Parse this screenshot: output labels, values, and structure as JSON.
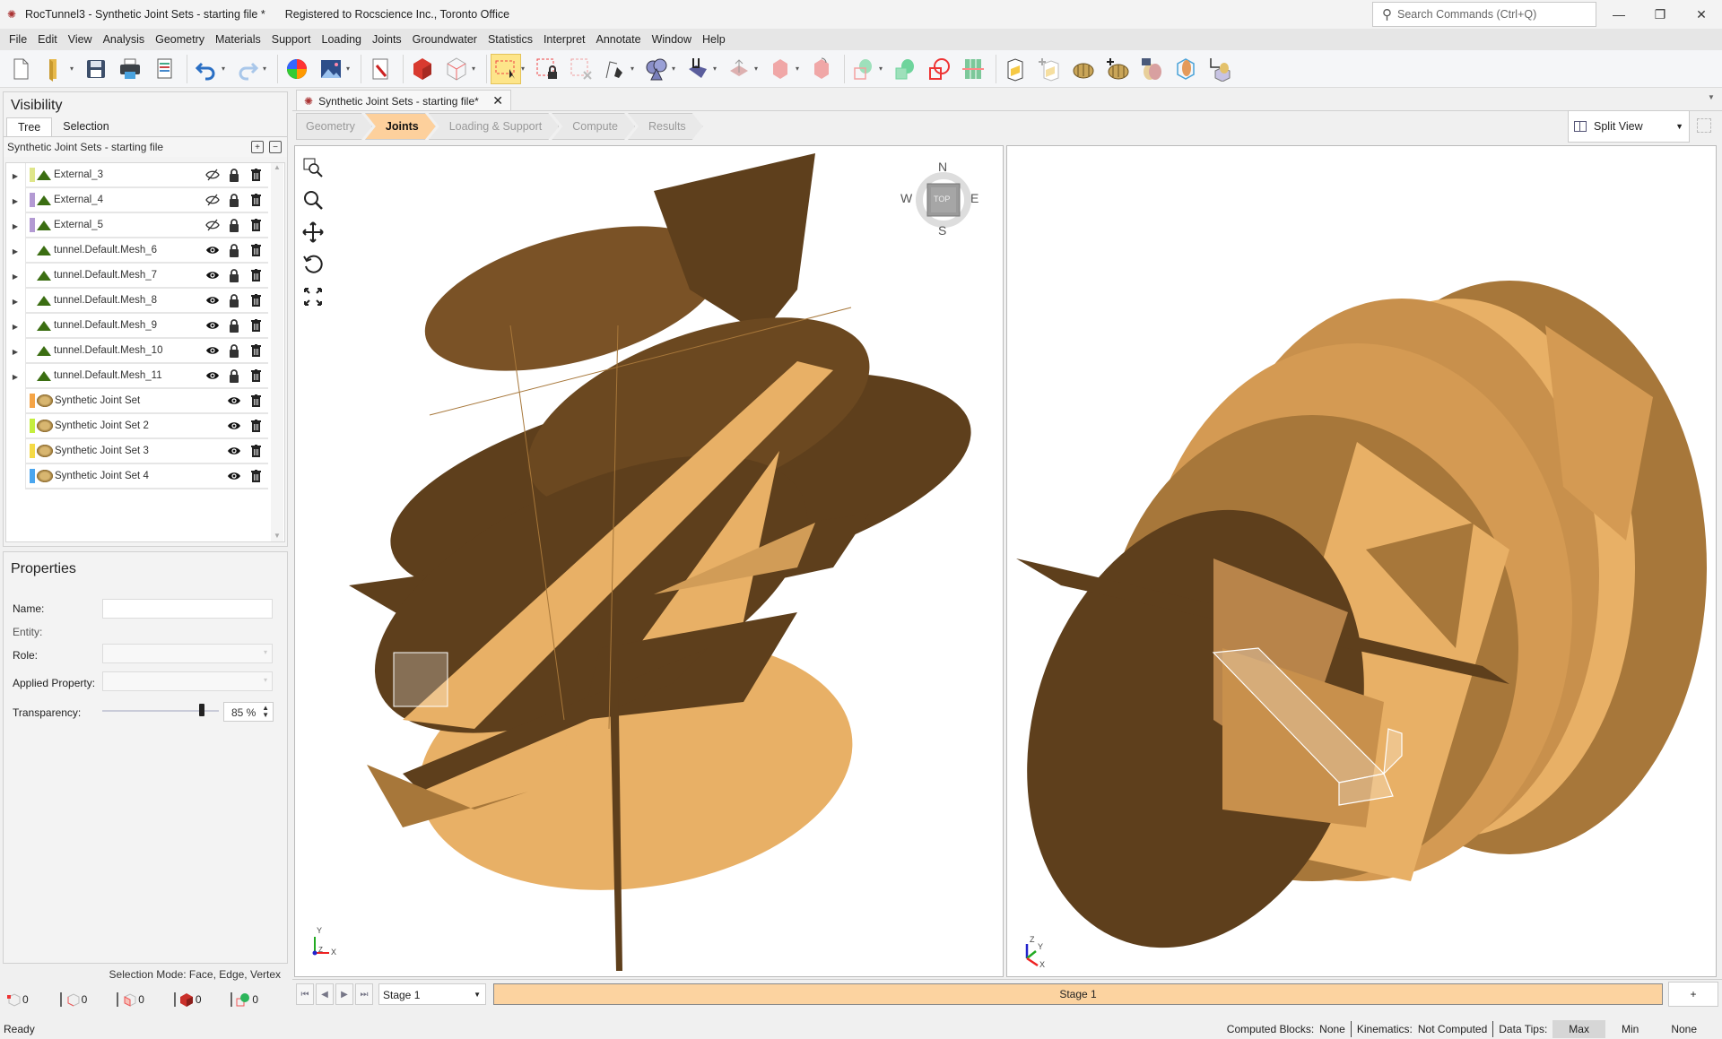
{
  "titlebar": {
    "title": "RocTunnel3 - Synthetic Joint Sets - starting file *",
    "registration": "Registered to Rocscience Inc., Toronto Office",
    "search_placeholder": "Search Commands (Ctrl+Q)",
    "minimize": "—",
    "restore": "❐",
    "close": "✕"
  },
  "menu": [
    "File",
    "Edit",
    "View",
    "Analysis",
    "Geometry",
    "Materials",
    "Support",
    "Loading",
    "Joints",
    "Groundwater",
    "Statistics",
    "Interpret",
    "Annotate",
    "Window",
    "Help"
  ],
  "toolbar": {
    "buttons": [
      {
        "icon": "new-file-icon",
        "dropdown": false
      },
      {
        "icon": "open-folder-icon",
        "dropdown": true
      },
      {
        "icon": "save-icon",
        "dropdown": false
      },
      {
        "icon": "print-icon",
        "dropdown": false
      },
      {
        "icon": "report-icon",
        "dropdown": false
      },
      {
        "icon": "undo-icon",
        "dropdown": true
      },
      {
        "icon": "redo-icon",
        "dropdown": true
      },
      {
        "icon": "color-wheel-icon",
        "dropdown": false
      },
      {
        "icon": "image-export-icon",
        "dropdown": true
      },
      {
        "icon": "project-settings-icon",
        "dropdown": false
      },
      {
        "icon": "solid-view-icon",
        "dropdown": false
      },
      {
        "icon": "wireframe-view-icon",
        "dropdown": true
      },
      {
        "icon": "box-select-icon",
        "dropdown": true,
        "active": true
      },
      {
        "icon": "lock-selection-icon",
        "dropdown": false
      },
      {
        "icon": "clear-selection-icon",
        "dropdown": false
      },
      {
        "icon": "polyline-pen-icon",
        "dropdown": true
      },
      {
        "icon": "shapes-icon",
        "dropdown": true
      },
      {
        "icon": "import-geometry-icon",
        "dropdown": true
      },
      {
        "icon": "extrude-icon",
        "dropdown": true
      },
      {
        "icon": "move-icon",
        "dropdown": true
      },
      {
        "icon": "rotate-icon",
        "dropdown": false
      },
      {
        "icon": "boolean-icon",
        "dropdown": true
      },
      {
        "icon": "union-icon",
        "dropdown": false
      },
      {
        "icon": "intersect-icon",
        "dropdown": false
      },
      {
        "icon": "grid-slice-icon",
        "dropdown": false
      },
      {
        "icon": "edit-joint-icon",
        "dropdown": false
      },
      {
        "icon": "add-joint-icon",
        "dropdown": false
      },
      {
        "icon": "edit-joint-set-icon",
        "dropdown": false
      },
      {
        "icon": "add-joint-set-icon",
        "dropdown": false
      },
      {
        "icon": "joint-table-icon",
        "dropdown": false
      },
      {
        "icon": "joint-box-icon",
        "dropdown": false
      },
      {
        "icon": "crop-box-icon",
        "dropdown": false
      }
    ]
  },
  "visibility": {
    "title": "Visibility",
    "tabs": [
      "Tree",
      "Selection"
    ],
    "active_tab": "Tree",
    "tree_header": "Synthetic Joint Sets - starting file",
    "items": [
      {
        "label": "External_3",
        "type": "mesh",
        "swatch": "#dfe68a",
        "expandable": true,
        "visible": false,
        "lock": true
      },
      {
        "label": "External_4",
        "type": "mesh",
        "swatch": "#b39ad3",
        "expandable": true,
        "visible": false,
        "lock": true
      },
      {
        "label": "External_5",
        "type": "mesh",
        "swatch": "#b39ad3",
        "expandable": true,
        "visible": false,
        "lock": true
      },
      {
        "label": "tunnel.Default.Mesh_6",
        "type": "mesh",
        "swatch": "",
        "expandable": true,
        "visible": true,
        "lock": true
      },
      {
        "label": "tunnel.Default.Mesh_7",
        "type": "mesh",
        "swatch": "",
        "expandable": true,
        "visible": true,
        "lock": true
      },
      {
        "label": "tunnel.Default.Mesh_8",
        "type": "mesh",
        "swatch": "",
        "expandable": true,
        "visible": true,
        "lock": true
      },
      {
        "label": "tunnel.Default.Mesh_9",
        "type": "mesh",
        "swatch": "",
        "expandable": true,
        "visible": true,
        "lock": true
      },
      {
        "label": "tunnel.Default.Mesh_10",
        "type": "mesh",
        "swatch": "",
        "expandable": true,
        "visible": true,
        "lock": true
      },
      {
        "label": "tunnel.Default.Mesh_11",
        "type": "mesh",
        "swatch": "",
        "expandable": true,
        "visible": true,
        "lock": true
      },
      {
        "label": "Synthetic Joint Set",
        "type": "joint",
        "swatch": "#f5a446",
        "expandable": false,
        "visible": true,
        "lock": false
      },
      {
        "label": "Synthetic Joint Set 2",
        "type": "joint",
        "swatch": "#c5ee3e",
        "expandable": false,
        "visible": true,
        "lock": false
      },
      {
        "label": "Synthetic Joint Set 3",
        "type": "joint",
        "swatch": "#f5da46",
        "expandable": false,
        "visible": true,
        "lock": false
      },
      {
        "label": "Synthetic Joint Set 4",
        "type": "joint",
        "swatch": "#4aa6ef",
        "expandable": false,
        "visible": true,
        "lock": false
      }
    ]
  },
  "properties": {
    "title": "Properties",
    "name_label": "Name:",
    "name_value": "",
    "entity_label": "Entity:",
    "role_label": "Role:",
    "applied_property_label": "Applied Property:",
    "transparency_label": "Transparency:",
    "transparency_value": "85 %",
    "transparency_fraction": 0.85
  },
  "selection": {
    "mode": "Selection Mode: Face, Edge, Vertex",
    "counts": [
      {
        "icon": "vertex-count-icon",
        "value": "0"
      },
      {
        "icon": "edge-count-icon",
        "value": "0"
      },
      {
        "icon": "face-count-icon",
        "value": "0"
      },
      {
        "icon": "solid-count-icon",
        "value": "0"
      },
      {
        "icon": "joint-count-icon",
        "value": "0"
      }
    ]
  },
  "document": {
    "tab_title": "Synthetic Joint Sets - starting file*",
    "workflow": [
      "Geometry",
      "Joints",
      "Loading & Support",
      "Compute",
      "Results"
    ],
    "active_step": "Joints",
    "view_mode": "Split View"
  },
  "viewport_left": {
    "compass": {
      "n": "N",
      "s": "S",
      "e": "E",
      "w": "W",
      "face": "TOP"
    },
    "axes": {
      "x": "X",
      "y": "Y",
      "z": "Z"
    }
  },
  "viewport_right": {
    "axes": {
      "x": "X",
      "y": "Y",
      "z": "Z"
    }
  },
  "colors": {
    "joint_dark": "#5e3f1c",
    "joint_mid": "#a7773a",
    "joint_light": "#e8b066",
    "accent_step": "#fdd09c",
    "stage_fill": "#fcd3a0"
  },
  "stages": {
    "selected": "Stage 1",
    "tabs": [
      "Stage 1"
    ],
    "add_label": "+"
  },
  "status": {
    "ready": "Ready",
    "computed_blocks_label": "Computed Blocks:",
    "computed_blocks_value": "None",
    "kinematics_label": "Kinematics:",
    "kinematics_value": "Not Computed",
    "data_tips_label": "Data Tips:",
    "data_tips_options": [
      "Max",
      "Min",
      "None"
    ],
    "data_tips_selected": "Max"
  }
}
